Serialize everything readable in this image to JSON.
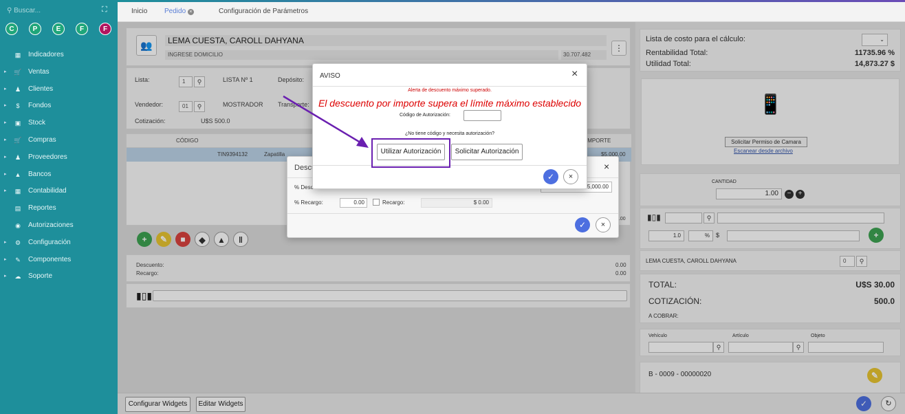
{
  "sidebar": {
    "search_placeholder": "Buscar...",
    "quick": [
      "C",
      "P",
      "E",
      "F",
      "F"
    ],
    "items": [
      {
        "label": "Indicadores",
        "icon": "grid-icon",
        "arrow": false
      },
      {
        "label": "Ventas",
        "icon": "cart-icon",
        "arrow": true
      },
      {
        "label": "Clientes",
        "icon": "users-icon",
        "arrow": true
      },
      {
        "label": "Fondos",
        "icon": "dollar-icon",
        "arrow": true
      },
      {
        "label": "Stock",
        "icon": "box-icon",
        "arrow": true
      },
      {
        "label": "Compras",
        "icon": "cart-icon",
        "arrow": true
      },
      {
        "label": "Proveedores",
        "icon": "users-icon",
        "arrow": true
      },
      {
        "label": "Bancos",
        "icon": "bank-icon",
        "arrow": true
      },
      {
        "label": "Contabilidad",
        "icon": "ledger-icon",
        "arrow": true
      },
      {
        "label": "Reportes",
        "icon": "report-icon",
        "arrow": false
      },
      {
        "label": "Autorizaciones",
        "icon": "lock-icon",
        "arrow": false
      },
      {
        "label": "Configuración",
        "icon": "gear-icon",
        "arrow": true
      },
      {
        "label": "Componentes",
        "icon": "pen-icon",
        "arrow": true
      },
      {
        "label": "Soporte",
        "icon": "cloud-icon",
        "arrow": true
      }
    ]
  },
  "tabs": {
    "inicio": "Inicio",
    "pedido": "Pedido",
    "config": "Configuración de Parámetros"
  },
  "client": {
    "name": "LEMA CUESTA, CAROLL DAHYANA",
    "address": "INGRESE DOMICILIO",
    "code": "30.707.482"
  },
  "order": {
    "lista_label": "Lista:",
    "lista_value": "1",
    "lista_name": "LISTA Nº 1",
    "deposito_label": "Depósito:",
    "vendedor_label": "Vendedor:",
    "vendedor_value": "01",
    "vendedor_name": "MOSTRADOR",
    "transporte_label": "Transporte:",
    "cotizacion_label": "Cotización:",
    "cotizacion_value": "U$S 500.0"
  },
  "grid": {
    "col_codigo": "CÓDIGO",
    "col_importe": "IMPORTE",
    "row_code": "TIN9394132",
    "row_desc": "Zapatilla",
    "row_amount": "$5,000.00",
    "side_amount": "0.00"
  },
  "totals": {
    "descuento_label": "Descuento:",
    "recargo_label": "Recargo:",
    "descuento_value": "0.00",
    "recargo_value": "0.00"
  },
  "bottom": {
    "configurar": "Configurar Widgets",
    "editar": "Editar Widgets"
  },
  "right": {
    "lista_costo": "Lista de costo para el cálculo:",
    "rentabilidad_label": "Rentabilidad Total:",
    "rentabilidad_value": "11735.96 %",
    "utilidad_label": "Utilidad Total:",
    "utilidad_value": "14,873.27 $",
    "camera_btn": "Solicitar Permiso de Camara",
    "scan_link": "Escanear desde archivo",
    "cantidad_label": "CANTIDAD",
    "cantidad_value": "1.00",
    "qty_small": "1.0",
    "pct": "%",
    "dollar": "$",
    "client_name": "LEMA CUESTA, CAROLL DAHYANA",
    "client_num": "0",
    "total_label": "TOTAL:",
    "total_value": "U$S 30.00",
    "cotiz_label": "COTIZACIÓN:",
    "cotiz_value": "500.0",
    "cobrar_label": "A COBRAR:",
    "vehiculo": "Vehículo",
    "articulo": "Artículo",
    "objeto": "Objeto",
    "comprobante": "B - 0009 - 00000020"
  },
  "descuento_modal": {
    "title": "Descu",
    "pct_desc": "% Desc",
    "pct_recargo": "% Recargo:",
    "recargo_value": "0.00",
    "recargo_check": "Recargo:",
    "recargo_amount": "$ 0.00",
    "amount": "5,000.00",
    "side": "0.00"
  },
  "aviso": {
    "title": "AVISO",
    "alert_small": "Alerta de descuento máximo superado.",
    "alert_big": "El descuento por importe supera el límite máximo establecido",
    "codigo_label": "Código de Autorización:",
    "no_code": "¿No tiene código y necesita autorización?",
    "utilizar": "Utilizar Autorización",
    "solicitar": "Solicitar Autorización"
  }
}
